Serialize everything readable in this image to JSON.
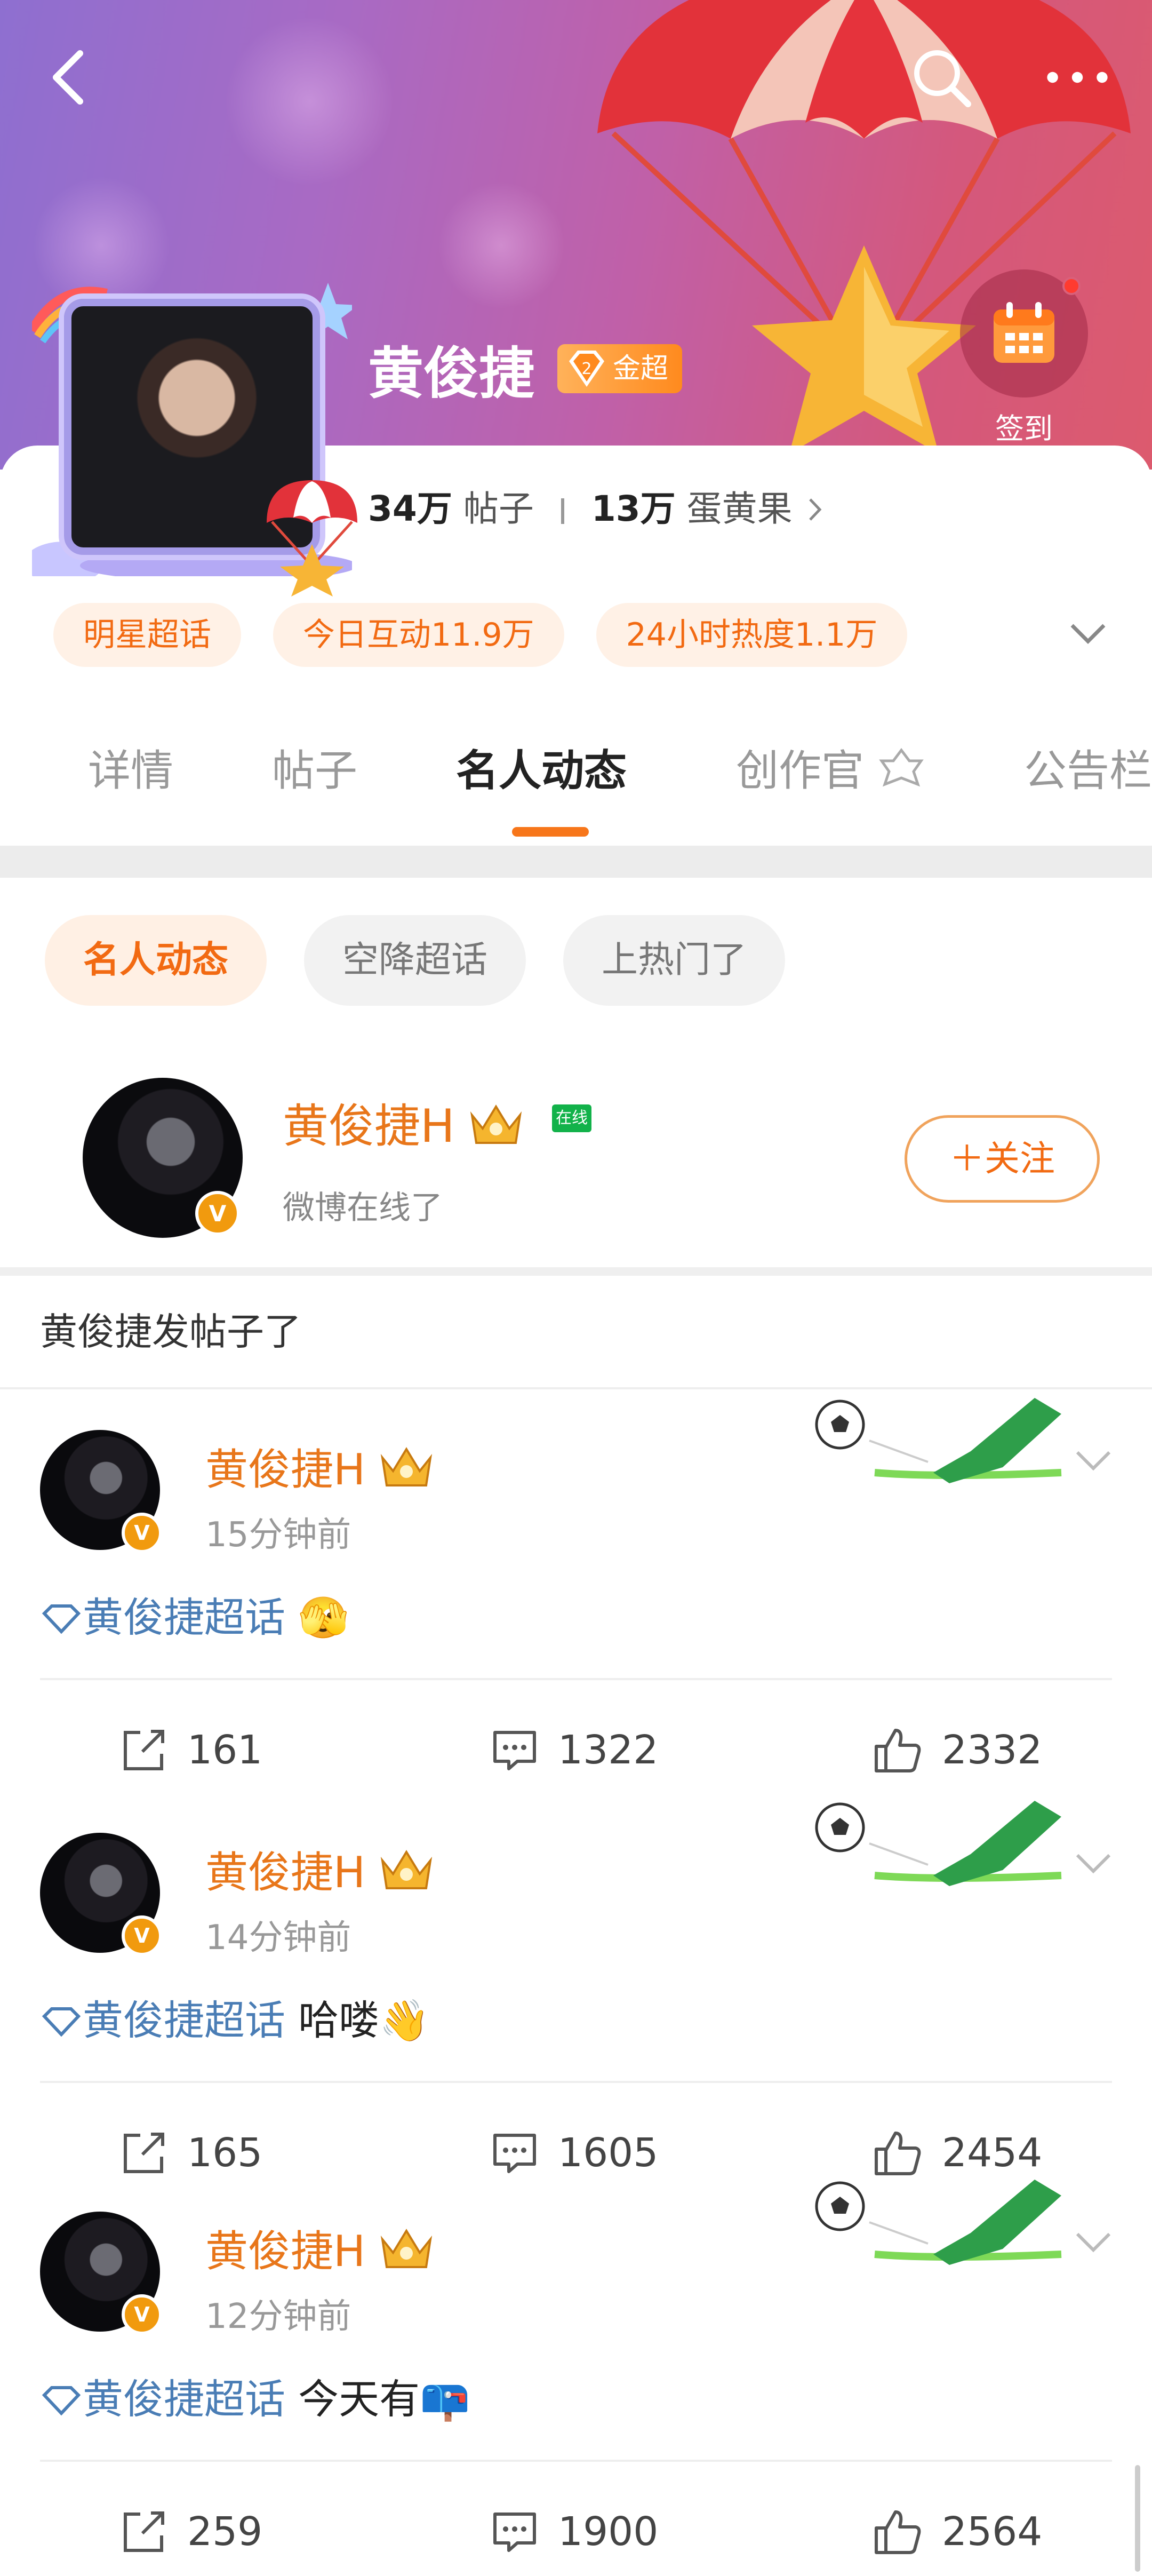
{
  "header": {
    "back_icon": "back-arrow-icon",
    "search_icon": "search-icon",
    "more_icon": "more-dots-icon",
    "checkin_label": "签到"
  },
  "profile": {
    "name": "黄俊捷",
    "badge_label": "金超",
    "posts_count": "34万",
    "posts_label": "帖子",
    "eggs_count": "13万",
    "eggs_label": "蛋黄果"
  },
  "tags": [
    "明星超话",
    "今日互动11.9万",
    "24小时热度1.1万"
  ],
  "tabs": [
    "详情",
    "帖子",
    "名人动态",
    "创作官",
    "公告栏"
  ],
  "subtabs": [
    "名人动态",
    "空降超话",
    "上热门了"
  ],
  "celebrity": {
    "name": "黄俊捷H",
    "online_label": "在线",
    "status": "微博在线了",
    "follow_label": "＋关注",
    "verified_mark": "V"
  },
  "section_title": "黄俊捷发帖子了",
  "posts": [
    {
      "name": "黄俊捷H",
      "time": "15分钟前",
      "topic": "黄俊捷超话",
      "text": " 🫣",
      "shares": "161",
      "comments": "1322",
      "likes": "2332"
    },
    {
      "name": "黄俊捷H",
      "time": "14分钟前",
      "topic": "黄俊捷超话",
      "text": " 哈喽👋",
      "shares": "165",
      "comments": "1605",
      "likes": "2454"
    },
    {
      "name": "黄俊捷H",
      "time": "12分钟前",
      "topic": "黄俊捷超话",
      "text": " 今天有📪",
      "shares": "259",
      "comments": "1900",
      "likes": "2564"
    }
  ],
  "colors": {
    "accent": "#f26a12",
    "name_orange": "#e8761a",
    "topic_blue": "#4a7db5",
    "online_green": "#12b24a"
  }
}
